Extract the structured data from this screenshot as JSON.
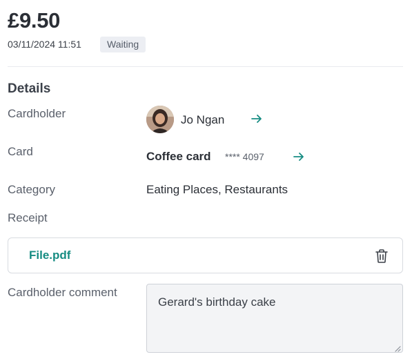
{
  "header": {
    "amount": "£9.50",
    "datetime": "03/11/2024 11:51",
    "status": "Waiting"
  },
  "details": {
    "title": "Details",
    "cardholder_label": "Cardholder",
    "cardholder_name": "Jo Ngan",
    "card_label": "Card",
    "card_name": "Coffee card",
    "card_masked": "**** 4097",
    "category_label": "Category",
    "category_value": "Eating Places, Restaurants",
    "receipt_label": "Receipt",
    "receipt_file": "File.pdf",
    "comment_label": "Cardholder comment",
    "comment_value": "Gerard's birthday cake"
  },
  "colors": {
    "accent": "#168c82",
    "badge_bg": "#eceef3"
  },
  "icons": {
    "cardholder_link": "arrow-right-icon",
    "card_link": "arrow-right-icon",
    "delete_receipt": "trash-icon"
  }
}
